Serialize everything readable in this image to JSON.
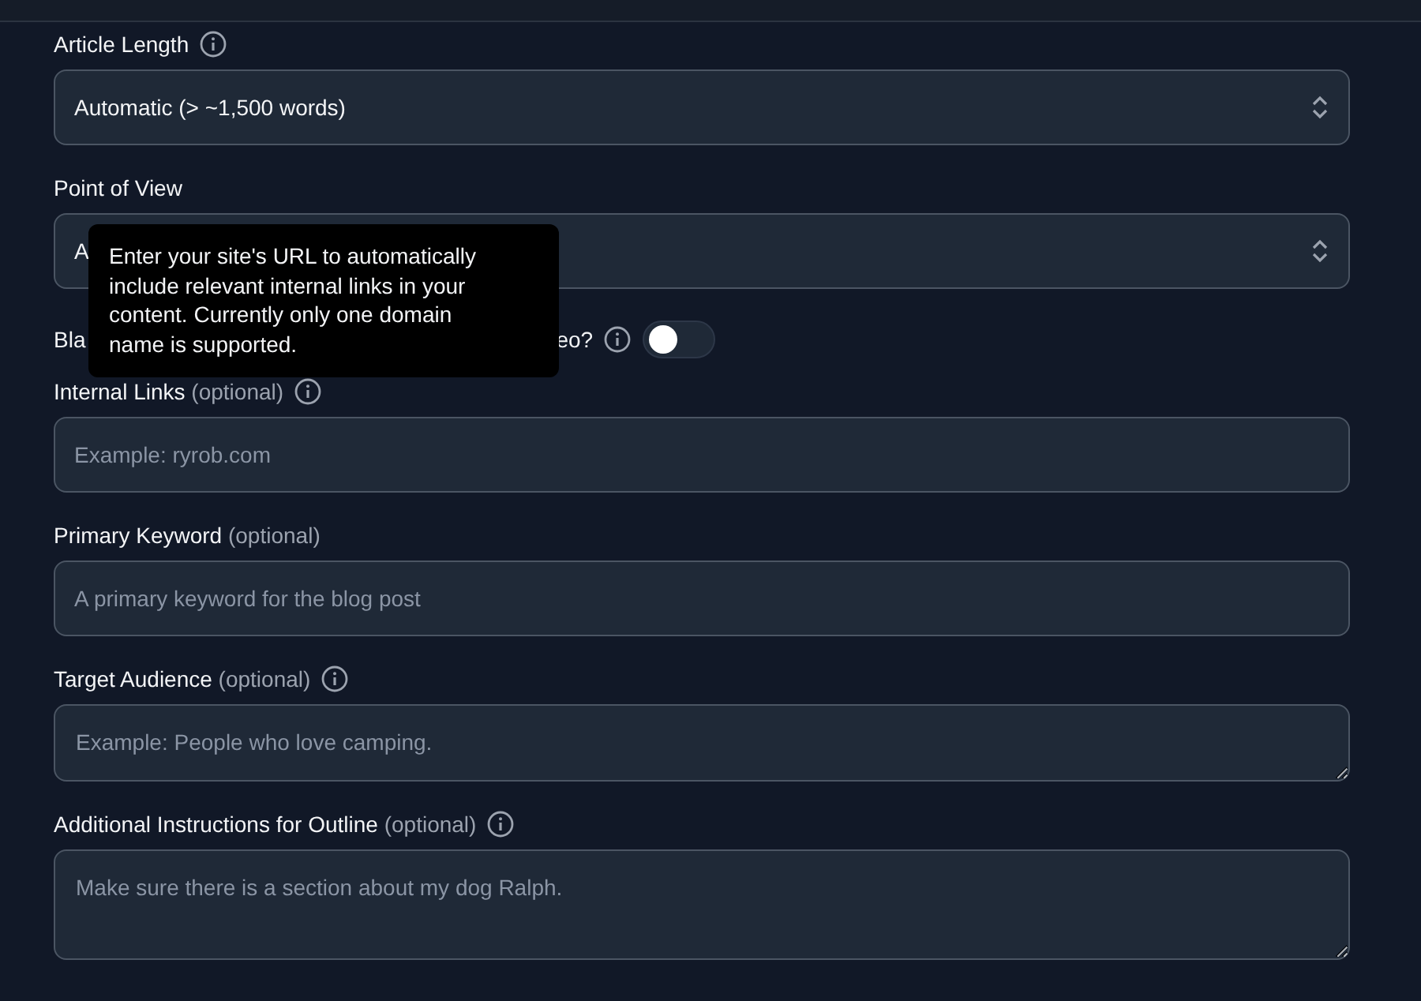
{
  "fields": [
    {
      "kind": "select",
      "label": "Article Length",
      "info": true,
      "value": "Automatic (> ~1,500 words)"
    },
    {
      "kind": "select",
      "label": "Point of View",
      "info": false,
      "value": "A"
    },
    {
      "kind": "toggle",
      "label_start": "Bla",
      "label_end": "eo?",
      "info": true,
      "on": false
    },
    {
      "kind": "input",
      "label": "Internal Links",
      "optional": "(optional)",
      "info": true,
      "placeholder": "Example: ryrob.com"
    },
    {
      "kind": "input",
      "label": "Primary Keyword",
      "optional": "(optional)",
      "info": false,
      "placeholder": "A primary keyword for the blog post"
    },
    {
      "kind": "textarea",
      "label": "Target Audience",
      "optional": "(optional)",
      "info": true,
      "placeholder": "Example: People who love camping."
    },
    {
      "kind": "textarea",
      "label": "Additional Instructions for Outline",
      "optional": "(optional)",
      "info": true,
      "placeholder": "Make sure there is a section about my dog Ralph."
    }
  ],
  "tooltip": {
    "text": "Enter your site's URL to automatically include relevant internal links in your content. Currently only one domain name is supported."
  }
}
